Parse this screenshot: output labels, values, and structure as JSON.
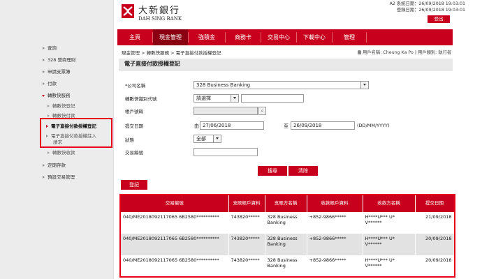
{
  "header": {
    "logo_cn": "大新銀行",
    "logo_en": "DAH SING BANK",
    "system_date_label": "A2 系統日期：",
    "system_date": "26/09/2018 19:03:01",
    "login_date_label": "登錄日期：",
    "login_date": "26/09/2018 19:03:01",
    "logout_label": "登出"
  },
  "nav": {
    "items": [
      "主頁",
      "現金管理",
      "強積金",
      "商務卡",
      "交易中心",
      "下載中心",
      "管理"
    ]
  },
  "breadcrumb": "現金管理 > 轉數快服務 > 電子直接付款授權登記",
  "user_info": "用戶名稱: Cheung Ka Po | 用戶類別: 執行者",
  "sidebar": {
    "items": [
      "查詢",
      "328 營商理財",
      "申請支票簿",
      "付款",
      "轉數快服務",
      "轉數快登記",
      "轉數快付款",
      "電子直接付款授權登記",
      "電子直接付款授權註入",
      "請求",
      "轉數快收款",
      "定期存款",
      "預設交易管理"
    ]
  },
  "form": {
    "title": "電子直接付款授權登記",
    "company_label": "*公司名稱",
    "company_value": "328 Business Banking",
    "proxy_type_label": "轉數快識別代號",
    "proxy_type_value": "請選擇",
    "account_label": "帳戶號碼",
    "submit_date_label": "提交日期",
    "from_label": "由",
    "from_date": "27/06/2018",
    "to_label": "至",
    "to_date": "26/09/2018",
    "date_format": "(DD/MM/YYYY)",
    "status_label": "狀態",
    "status_value": "全部",
    "txn_no_label": "交易編號",
    "search_label": "搜尋",
    "clear_label": "清除",
    "register_label": "登記"
  },
  "table": {
    "headers": [
      "交易編號",
      "支賬帳戶資料",
      "支賬方名稱",
      "收款帳戶資料",
      "收款方名稱",
      "提交日期"
    ],
    "rows": [
      [
        "040/ME2018092117065 6B2580**********",
        "743820*****",
        "328 Business Banking",
        "+852-9866*****",
        "H****U*** U* V******",
        "21/09/2018"
      ],
      [
        "040/ME2018092117065 6B2580**********",
        "743820*****",
        "328 Business Banking",
        "+852-9866*****",
        "H****U*** U* V******",
        "20/09/2018"
      ],
      [
        "040/ME2018092117065 6B2580**********",
        "743820*****",
        "328 Business Banking",
        "+852-9866*****",
        "H****U*** U* V******",
        "20/09/2018"
      ]
    ]
  },
  "colors": {
    "brand_red": "#c8001e",
    "highlight": "#e8001a"
  }
}
